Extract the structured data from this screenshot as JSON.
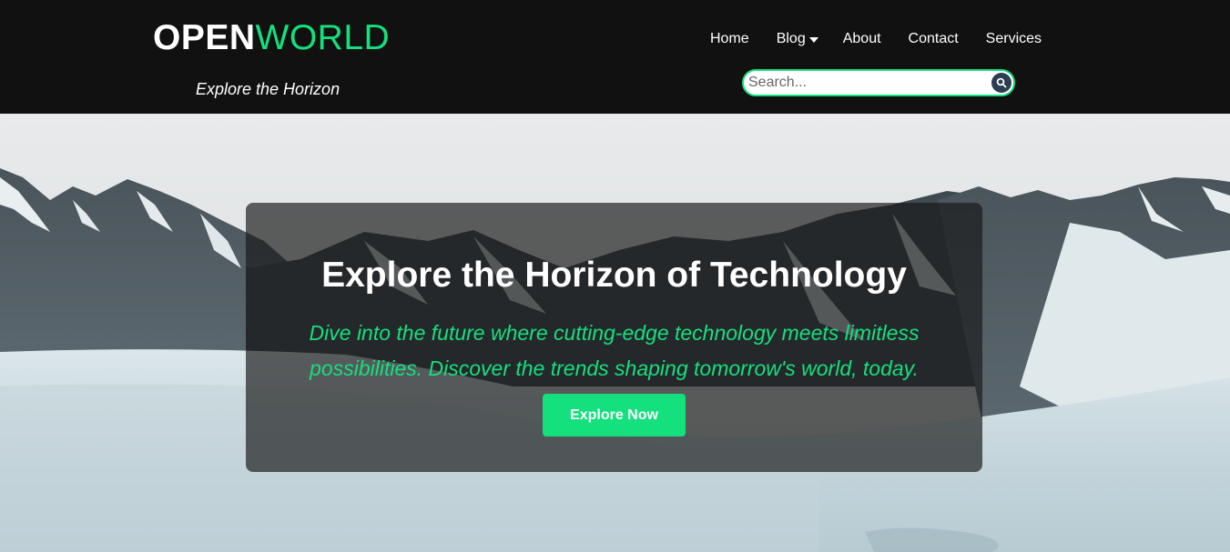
{
  "brand": {
    "logo_part_a": "OPEN",
    "logo_part_b": "WORLD",
    "tagline": "Explore the Horizon"
  },
  "nav": {
    "items": [
      {
        "label": "Home"
      },
      {
        "label": "Blog",
        "has_dropdown": true
      },
      {
        "label": "About"
      },
      {
        "label": "Contact"
      },
      {
        "label": "Services"
      }
    ]
  },
  "search": {
    "placeholder": "Search...",
    "value": "",
    "icon": "search-icon"
  },
  "hero": {
    "title": "Explore the Horizon of Technology",
    "subtitle": "Dive into the future where cutting-edge technology meets limitless possibilities. Discover the trends shaping tomorrow's world, today.",
    "cta_label": "Explore Now",
    "background": "snowy mountain landscape"
  },
  "colors": {
    "header_bg": "#111111",
    "accent": "#14e07e",
    "search_button": "#2c3e50"
  }
}
